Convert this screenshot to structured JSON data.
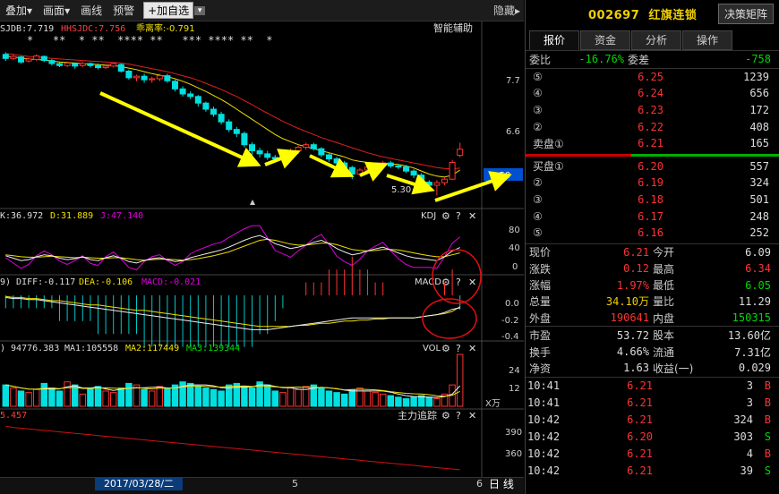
{
  "toolbar": {
    "overlay": "叠加",
    "draw": "画面",
    "line": "画线",
    "alert": "预警",
    "add_watch": "+加自选",
    "hide": "隐藏"
  },
  "main_chart": {
    "sjdb_label": "SJDB:7.719",
    "hhsjdc_label": "HHSJDC:7.756",
    "deviation_label": "乖离率:-0.791",
    "assist": "智能辅助",
    "stars": "*   **  * **  **** **   *** **** **  *",
    "y_ticks": [
      "7.7",
      "6.6",
      "5.50"
    ],
    "low_label": "5.30",
    "current_price_tag": "5.50"
  },
  "kdj": {
    "k_label": "K:36.972",
    "d_label": "D:31.889",
    "j_label": "J:47.140",
    "name": "KDJ",
    "y_ticks": [
      "80",
      "40",
      "0"
    ]
  },
  "macd": {
    "diff_label": "9) DIFF:-0.117",
    "dea_label": "DEA:-0.106",
    "macd_label": "MACD:-0.021",
    "name": "MACD",
    "y_ticks": [
      "0.0",
      "-0.2",
      "-0.4"
    ]
  },
  "vol": {
    "vol_label": ") 94776.383",
    "ma1_label": "MA1:105558",
    "ma2_label": "MA2:117449",
    "ma3_label": "MA3:139344",
    "name": "VOL",
    "y_ticks": [
      "24",
      "12"
    ],
    "unit": "X万"
  },
  "main_force": {
    "value_label": "5.457",
    "name": "主力追踪",
    "y_ticks": [
      "390",
      "360"
    ]
  },
  "bottom": {
    "date": "2017/03/28/二",
    "mark5": "5",
    "mark6": "6",
    "period": "日 线"
  },
  "stock": {
    "code": "002697",
    "name": "红旗连锁",
    "decision_button": "决策矩阵"
  },
  "tabs": [
    "报价",
    "资金",
    "分析",
    "操作"
  ],
  "ratio": {
    "wb_label": "委比",
    "wb_value": "-16.76%",
    "wc_label": "委差",
    "wc_value": "-758"
  },
  "sell_orders": [
    {
      "label": "⑤",
      "price": "6.25",
      "vol": "1239"
    },
    {
      "label": "④",
      "price": "6.24",
      "vol": "656"
    },
    {
      "label": "③",
      "price": "6.23",
      "vol": "172"
    },
    {
      "label": "②",
      "price": "6.22",
      "vol": "408"
    },
    {
      "label": "卖盘①",
      "price": "6.21",
      "vol": "165"
    }
  ],
  "buy_orders": [
    {
      "label": "买盘①",
      "price": "6.20",
      "vol": "557"
    },
    {
      "label": "②",
      "price": "6.19",
      "vol": "324"
    },
    {
      "label": "③",
      "price": "6.18",
      "vol": "501"
    },
    {
      "label": "④",
      "price": "6.17",
      "vol": "248"
    },
    {
      "label": "⑤",
      "price": "6.16",
      "vol": "252"
    }
  ],
  "quote": [
    {
      "l": "现价",
      "lv": "6.21",
      "lc": "red",
      "r": "今开",
      "rv": "6.09",
      "rc": "white"
    },
    {
      "l": "涨跌",
      "lv": "0.12",
      "lc": "red",
      "r": "最高",
      "rv": "6.34",
      "rc": "red"
    },
    {
      "l": "涨幅",
      "lv": "1.97%",
      "lc": "red",
      "r": "最低",
      "rv": "6.05",
      "rc": "green"
    },
    {
      "l": "总量",
      "lv": "34.10万",
      "lc": "yellow",
      "r": "量比",
      "rv": "11.29",
      "rc": "white"
    },
    {
      "l": "外盘",
      "lv": "190641",
      "lc": "red",
      "r": "内盘",
      "rv": "150315",
      "rc": "green"
    }
  ],
  "quote2": [
    {
      "l": "市盈",
      "lv": "53.72",
      "r": "股本",
      "rv": "13.60亿"
    },
    {
      "l": "换手",
      "lv": "4.66%",
      "r": "流通",
      "rv": "7.31亿"
    },
    {
      "l": "净资",
      "lv": "1.63",
      "r": "收益(一)",
      "rv": "0.029"
    }
  ],
  "ticks": [
    {
      "time": "10:41",
      "price": "6.21",
      "vol": "3",
      "dir": "B"
    },
    {
      "time": "10:41",
      "price": "6.21",
      "vol": "3",
      "dir": "B"
    },
    {
      "time": "10:42",
      "price": "6.21",
      "vol": "324",
      "dir": "B"
    },
    {
      "time": "10:42",
      "price": "6.20",
      "vol": "303",
      "dir": "S"
    },
    {
      "time": "10:42",
      "price": "6.21",
      "vol": "4",
      "dir": "B"
    },
    {
      "time": "10:42",
      "price": "6.21",
      "vol": "39",
      "dir": "S"
    }
  ],
  "colors": {
    "up": "#ff3232",
    "down": "#00e0e0",
    "ma_yellow": "#f0e000",
    "ma_purple": "#e000e0",
    "annot_yellow": "#ffff00",
    "circle_red": "#e01010"
  },
  "chart_data": {
    "type": "candlestick",
    "title": "",
    "candles": [
      {
        "o": 8.08,
        "c": 8.0,
        "h": 8.12,
        "l": 7.95
      },
      {
        "o": 8.0,
        "c": 8.04,
        "h": 8.08,
        "l": 7.97
      },
      {
        "o": 8.03,
        "c": 7.93,
        "h": 8.05,
        "l": 7.9
      },
      {
        "o": 7.95,
        "c": 7.99,
        "h": 8.02,
        "l": 7.92
      },
      {
        "o": 7.98,
        "c": 8.05,
        "h": 8.08,
        "l": 7.95
      },
      {
        "o": 8.04,
        "c": 7.96,
        "h": 8.06,
        "l": 7.93
      },
      {
        "o": 7.96,
        "c": 7.9,
        "h": 7.99,
        "l": 7.86
      },
      {
        "o": 7.9,
        "c": 7.86,
        "h": 7.93,
        "l": 7.83
      },
      {
        "o": 7.86,
        "c": 7.91,
        "h": 7.94,
        "l": 7.83
      },
      {
        "o": 7.9,
        "c": 7.85,
        "h": 7.92,
        "l": 7.8
      },
      {
        "o": 7.86,
        "c": 7.9,
        "h": 7.93,
        "l": 7.83
      },
      {
        "o": 7.9,
        "c": 7.86,
        "h": 7.92,
        "l": 7.82
      },
      {
        "o": 7.86,
        "c": 7.82,
        "h": 7.9,
        "l": 7.78
      },
      {
        "o": 7.82,
        "c": 7.85,
        "h": 7.88,
        "l": 7.79
      },
      {
        "o": 7.85,
        "c": 7.9,
        "h": 7.92,
        "l": 7.82
      },
      {
        "o": 7.88,
        "c": 7.75,
        "h": 7.9,
        "l": 7.72
      },
      {
        "o": 7.75,
        "c": 7.62,
        "h": 7.78,
        "l": 7.58
      },
      {
        "o": 7.62,
        "c": 7.65,
        "h": 7.68,
        "l": 7.55
      },
      {
        "o": 7.65,
        "c": 7.58,
        "h": 7.7,
        "l": 7.52
      },
      {
        "o": 7.58,
        "c": 7.6,
        "h": 7.64,
        "l": 7.52
      },
      {
        "o": 7.6,
        "c": 7.66,
        "h": 7.7,
        "l": 7.55
      },
      {
        "o": 7.66,
        "c": 7.56,
        "h": 7.7,
        "l": 7.52
      },
      {
        "o": 7.55,
        "c": 7.4,
        "h": 7.58,
        "l": 7.35
      },
      {
        "o": 7.4,
        "c": 7.3,
        "h": 7.45,
        "l": 7.25
      },
      {
        "o": 7.3,
        "c": 7.25,
        "h": 7.35,
        "l": 7.2
      },
      {
        "o": 7.25,
        "c": 7.12,
        "h": 7.28,
        "l": 7.05
      },
      {
        "o": 7.12,
        "c": 7.0,
        "h": 7.15,
        "l": 6.95
      },
      {
        "o": 7.0,
        "c": 6.9,
        "h": 7.05,
        "l": 6.85
      },
      {
        "o": 6.9,
        "c": 6.75,
        "h": 6.95,
        "l": 6.7
      },
      {
        "o": 6.75,
        "c": 6.6,
        "h": 6.8,
        "l": 6.55
      },
      {
        "o": 6.6,
        "c": 6.52,
        "h": 6.65,
        "l": 6.45
      },
      {
        "o": 6.52,
        "c": 6.3,
        "h": 6.56,
        "l": 6.25
      },
      {
        "o": 6.3,
        "c": 6.18,
        "h": 6.35,
        "l": 6.1
      },
      {
        "o": 6.18,
        "c": 6.12,
        "h": 6.24,
        "l": 6.05
      },
      {
        "o": 6.12,
        "c": 6.05,
        "h": 6.18,
        "l": 6.0
      },
      {
        "o": 6.05,
        "c": 6.02,
        "h": 6.1,
        "l": 5.97
      },
      {
        "o": 6.02,
        "c": 6.12,
        "h": 6.15,
        "l": 5.98
      },
      {
        "o": 6.12,
        "c": 6.18,
        "h": 6.22,
        "l": 6.08
      },
      {
        "o": 6.18,
        "c": 6.25,
        "h": 6.28,
        "l": 6.12
      },
      {
        "o": 6.25,
        "c": 6.3,
        "h": 6.34,
        "l": 6.2
      },
      {
        "o": 6.3,
        "c": 6.22,
        "h": 6.34,
        "l": 6.18
      },
      {
        "o": 6.22,
        "c": 6.1,
        "h": 6.25,
        "l": 6.05
      },
      {
        "o": 6.1,
        "c": 6.02,
        "h": 6.14,
        "l": 5.96
      },
      {
        "o": 6.02,
        "c": 5.94,
        "h": 6.06,
        "l": 5.88
      },
      {
        "o": 5.94,
        "c": 5.85,
        "h": 5.98,
        "l": 5.8
      },
      {
        "o": 5.85,
        "c": 5.72,
        "h": 5.88,
        "l": 5.62
      },
      {
        "o": 5.72,
        "c": 5.8,
        "h": 5.84,
        "l": 5.68
      },
      {
        "o": 5.8,
        "c": 5.86,
        "h": 5.9,
        "l": 5.76
      },
      {
        "o": 5.86,
        "c": 5.9,
        "h": 5.94,
        "l": 5.82
      },
      {
        "o": 5.9,
        "c": 5.94,
        "h": 5.98,
        "l": 5.85
      },
      {
        "o": 5.94,
        "c": 5.88,
        "h": 5.98,
        "l": 5.84
      },
      {
        "o": 5.88,
        "c": 5.86,
        "h": 5.92,
        "l": 5.82
      },
      {
        "o": 5.86,
        "c": 5.78,
        "h": 5.9,
        "l": 5.74
      },
      {
        "o": 5.78,
        "c": 5.7,
        "h": 5.82,
        "l": 5.64
      },
      {
        "o": 5.7,
        "c": 5.56,
        "h": 5.74,
        "l": 5.48
      },
      {
        "o": 5.56,
        "c": 5.5,
        "h": 5.6,
        "l": 5.4
      },
      {
        "o": 5.5,
        "c": 5.55,
        "h": 5.6,
        "l": 5.3
      },
      {
        "o": 5.55,
        "c": 5.62,
        "h": 5.66,
        "l": 5.5
      },
      {
        "o": 5.62,
        "c": 5.95,
        "h": 6.0,
        "l": 5.6
      },
      {
        "o": 6.09,
        "c": 6.21,
        "h": 6.34,
        "l": 6.05
      }
    ],
    "ylim": [
      5.2,
      8.2
    ],
    "ma1": [
      8.05,
      8.03,
      8.01,
      7.99,
      7.98,
      7.97,
      7.95,
      7.93,
      7.92,
      7.91,
      7.9,
      7.89,
      7.88,
      7.87,
      7.86,
      7.84,
      7.81,
      7.78,
      7.74,
      7.7,
      7.67,
      7.64,
      7.6,
      7.55,
      7.49,
      7.42,
      7.35,
      7.27,
      7.19,
      7.1,
      7.0,
      6.9,
      6.8,
      6.7,
      6.6,
      6.5,
      6.42,
      6.36,
      6.3,
      6.26,
      6.22,
      6.18,
      6.14,
      6.1,
      6.06,
      6.0,
      5.97,
      5.95,
      5.94,
      5.93,
      5.92,
      5.91,
      5.88,
      5.84,
      5.78,
      5.72,
      5.68,
      5.66,
      5.7,
      5.8
    ],
    "ma2": [
      8.1,
      8.08,
      8.06,
      8.04,
      8.03,
      8.02,
      8.0,
      7.99,
      7.98,
      7.97,
      7.96,
      7.95,
      7.94,
      7.93,
      7.92,
      7.91,
      7.89,
      7.86,
      7.83,
      7.8,
      7.77,
      7.74,
      7.7,
      7.66,
      7.62,
      7.57,
      7.51,
      7.45,
      7.39,
      7.32,
      7.25,
      7.17,
      7.09,
      7.0,
      6.92,
      6.84,
      6.76,
      6.69,
      6.62,
      6.56,
      6.5,
      6.44,
      6.39,
      6.34,
      6.29,
      6.24,
      6.19,
      6.14,
      6.1,
      6.06,
      6.03,
      6.0,
      5.97,
      5.94,
      5.91,
      5.88,
      5.85,
      5.83,
      5.82,
      5.84
    ],
    "kdj_k": [
      30,
      25,
      20,
      22,
      28,
      32,
      30,
      25,
      22,
      24,
      28,
      22,
      20,
      26,
      30,
      25,
      18,
      15,
      20,
      24,
      26,
      22,
      18,
      20,
      26,
      30,
      34,
      38,
      42,
      48,
      55,
      62,
      68,
      72,
      65,
      55,
      50,
      45,
      48,
      52,
      58,
      62,
      55,
      45,
      38,
      32,
      35,
      40,
      44,
      48,
      42,
      36,
      30,
      26,
      24,
      22,
      20,
      28,
      40,
      47
    ],
    "kdj_d": [
      32,
      30,
      28,
      27,
      27,
      28,
      29,
      28,
      27,
      26,
      27,
      26,
      25,
      25,
      26,
      26,
      24,
      22,
      21,
      22,
      23,
      23,
      22,
      21,
      22,
      24,
      27,
      30,
      34,
      38,
      44,
      50,
      56,
      62,
      64,
      62,
      58,
      54,
      52,
      52,
      54,
      56,
      56,
      53,
      48,
      43,
      41,
      40,
      41,
      43,
      43,
      42,
      39,
      36,
      33,
      30,
      28,
      28,
      32,
      36
    ],
    "kdj_j": [
      26,
      15,
      4,
      12,
      30,
      40,
      32,
      19,
      12,
      20,
      30,
      14,
      10,
      28,
      38,
      23,
      6,
      1,
      18,
      28,
      32,
      20,
      10,
      18,
      34,
      42,
      48,
      54,
      58,
      68,
      77,
      86,
      92,
      92,
      67,
      41,
      34,
      27,
      40,
      52,
      66,
      74,
      53,
      29,
      18,
      10,
      23,
      40,
      50,
      58,
      40,
      24,
      12,
      6,
      6,
      6,
      4,
      28,
      56,
      69
    ],
    "macd_diff": [
      -0.02,
      -0.03,
      -0.03,
      -0.04,
      -0.04,
      -0.05,
      -0.06,
      -0.07,
      -0.08,
      -0.09,
      -0.1,
      -0.11,
      -0.12,
      -0.13,
      -0.14,
      -0.15,
      -0.16,
      -0.17,
      -0.18,
      -0.19,
      -0.2,
      -0.21,
      -0.22,
      -0.23,
      -0.24,
      -0.25,
      -0.26,
      -0.27,
      -0.28,
      -0.29,
      -0.3,
      -0.31,
      -0.32,
      -0.32,
      -0.32,
      -0.31,
      -0.3,
      -0.29,
      -0.28,
      -0.27,
      -0.26,
      -0.25,
      -0.24,
      -0.23,
      -0.22,
      -0.21,
      -0.21,
      -0.21,
      -0.21,
      -0.21,
      -0.21,
      -0.21,
      -0.21,
      -0.21,
      -0.2,
      -0.19,
      -0.18,
      -0.16,
      -0.13,
      -0.117
    ],
    "macd_dea": [
      -0.01,
      -0.02,
      -0.02,
      -0.03,
      -0.03,
      -0.04,
      -0.05,
      -0.05,
      -0.06,
      -0.07,
      -0.08,
      -0.09,
      -0.09,
      -0.1,
      -0.11,
      -0.12,
      -0.13,
      -0.14,
      -0.14,
      -0.15,
      -0.16,
      -0.17,
      -0.18,
      -0.19,
      -0.2,
      -0.21,
      -0.22,
      -0.23,
      -0.24,
      -0.25,
      -0.26,
      -0.27,
      -0.28,
      -0.29,
      -0.29,
      -0.29,
      -0.29,
      -0.29,
      -0.28,
      -0.28,
      -0.27,
      -0.26,
      -0.26,
      -0.25,
      -0.24,
      -0.24,
      -0.23,
      -0.23,
      -0.22,
      -0.22,
      -0.21,
      -0.21,
      -0.21,
      -0.21,
      -0.2,
      -0.19,
      -0.18,
      -0.17,
      -0.15,
      -0.106
    ],
    "volume": [
      14,
      12,
      10,
      9,
      11,
      15,
      12,
      10,
      16,
      14,
      8,
      12,
      13,
      10,
      9,
      12,
      15,
      14,
      11,
      10,
      13,
      12,
      14,
      16,
      15,
      13,
      12,
      11,
      10,
      14,
      15,
      13,
      12,
      16,
      14,
      10,
      9,
      12,
      11,
      13,
      14,
      12,
      10,
      9,
      8,
      11,
      12,
      10,
      9,
      8,
      7,
      6,
      5,
      6,
      7,
      6,
      5,
      8,
      14,
      34
    ],
    "volume_up": [
      false,
      true,
      false,
      true,
      true,
      false,
      false,
      false,
      true,
      false,
      true,
      false,
      false,
      true,
      true,
      false,
      false,
      true,
      false,
      true,
      true,
      false,
      false,
      false,
      false,
      false,
      false,
      false,
      false,
      false,
      false,
      false,
      false,
      false,
      false,
      false,
      true,
      true,
      true,
      true,
      false,
      false,
      false,
      false,
      false,
      false,
      true,
      true,
      true,
      true,
      false,
      false,
      false,
      false,
      false,
      false,
      true,
      true,
      true,
      true
    ],
    "main_force": [
      400,
      398,
      397,
      396,
      395,
      394,
      393,
      392,
      391,
      390,
      389,
      388,
      387,
      386,
      385,
      384,
      383,
      382,
      381,
      380,
      379,
      378,
      377,
      376,
      375,
      374,
      373,
      372,
      371,
      370,
      369,
      368,
      367,
      366,
      365,
      364,
      363,
      362,
      361,
      360,
      359,
      358,
      357,
      356,
      355,
      354,
      353,
      352,
      351,
      350,
      349,
      348,
      347,
      346,
      345,
      344,
      343,
      342,
      341,
      340
    ],
    "mf_ylim": [
      335,
      405
    ]
  }
}
